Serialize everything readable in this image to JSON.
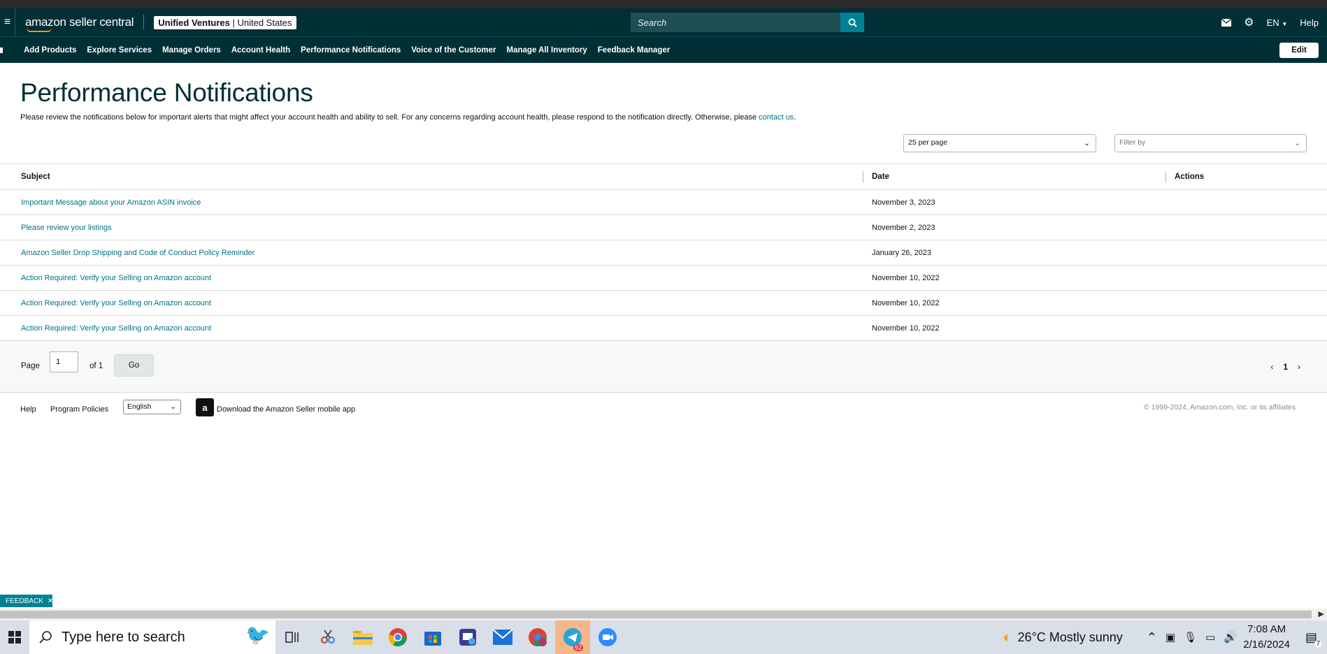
{
  "header": {
    "logo": "amazon seller central",
    "account": {
      "name": "Unified Ventures",
      "region": "United States"
    },
    "search_placeholder": "Search",
    "language": "EN",
    "help": "Help"
  },
  "nav": {
    "items": [
      "Add Products",
      "Explore Services",
      "Manage Orders",
      "Account Health",
      "Performance Notifications",
      "Voice of the Customer",
      "Manage All Inventory",
      "Feedback Manager"
    ],
    "edit_label": "Edit"
  },
  "page": {
    "title": "Performance Notifications",
    "description": "Please review the notifications below for important alerts that might affect your account health and ability to sell. For any concerns regarding account health, please respond to the notification directly. Otherwise, please ",
    "contact_link": "contact us",
    "per_page": "25 per page",
    "filter_placeholder": "Filter by"
  },
  "table": {
    "columns": [
      "Subject",
      "Date",
      "Actions"
    ],
    "rows": [
      {
        "subject": "Important Message about your Amazon ASIN invoice",
        "date": "November 3, 2023"
      },
      {
        "subject": "Please review your listings",
        "date": "November 2, 2023"
      },
      {
        "subject": "Amazon Seller Drop Shipping and Code of Conduct Policy Reminder",
        "date": "January 26, 2023"
      },
      {
        "subject": "Action Required: Verify your Selling on Amazon account",
        "date": "November 10, 2022"
      },
      {
        "subject": "Action Required: Verify your Selling on Amazon account",
        "date": "November 10, 2022"
      },
      {
        "subject": "Action Required: Verify your Selling on Amazon account",
        "date": "November 10, 2022"
      }
    ]
  },
  "pager": {
    "page_label": "Page",
    "page_value": "1",
    "of_label": "of 1",
    "go_label": "Go",
    "current": "1"
  },
  "footer": {
    "help": "Help",
    "policies": "Program Policies",
    "language": "English",
    "app_text": "Download the Amazon Seller mobile app",
    "copyright": "© 1999-2024, Amazon.com, Inc. or its affiliates"
  },
  "feedback_tab": "FEEDBACK",
  "taskbar": {
    "search_placeholder": "Type here to search",
    "weather": "26°C  Mostly sunny",
    "time": "7:08 AM",
    "date": "2/16/2024",
    "telegram_badge": "92",
    "notification_count": "7"
  }
}
